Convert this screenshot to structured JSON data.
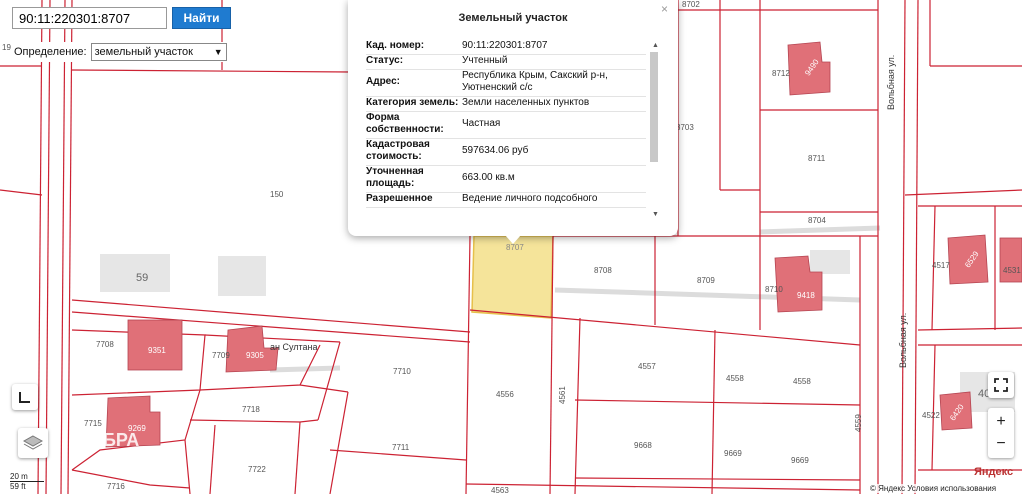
{
  "search": {
    "value": "90:11:220301:8707",
    "button_label": "Найти"
  },
  "definition": {
    "label": "Определение:",
    "selected": "земельный участок"
  },
  "popup": {
    "title": "Земельный участок",
    "close_label": "×",
    "rows": [
      {
        "key": "Кад. номер:",
        "value": "90:11:220301:8707"
      },
      {
        "key": "Статус:",
        "value": "Учтенный"
      },
      {
        "key": "Адрес:",
        "value": "Республика Крым, Сакский р-н, Уютненский с/с"
      },
      {
        "key": "Категория земель:",
        "value": "Земли населенных пунктов"
      },
      {
        "key": "Форма собственности:",
        "value": "Частная"
      },
      {
        "key": "Кадастровая стоимость:",
        "value": "597634.06 руб"
      },
      {
        "key": "Уточненная площадь:",
        "value": "663.00 кв.м"
      },
      {
        "key": "Разрешенное",
        "value": "Ведение личного подсобного"
      }
    ],
    "scroll_up": "▲",
    "scroll_down": "▼"
  },
  "parcels": {
    "p150": "150",
    "p59": "59",
    "p7708": "7708",
    "p9351": "9351",
    "p7709": "7709",
    "p9305": "9305",
    "p7710": "7710",
    "p7718": "7718",
    "p7715": "7715",
    "p9269": "9269",
    "p7711": "7711",
    "p7722": "7722",
    "p7716": "7716",
    "p4563": "4563",
    "p4556": "4556",
    "p4561": "4561",
    "p4557": "4557",
    "p4558a": "4558",
    "p4558b": "4558",
    "p9668": "9668",
    "p9669a": "9669",
    "p9669b": "9669",
    "p4559": "4559",
    "p8707": "8707",
    "p8708": "8708",
    "p8709": "8709",
    "p8710": "8710",
    "p9418": "9418",
    "p8703": "8703",
    "p8704": "8704",
    "p8711": "8711",
    "p8712": "8712",
    "p9490": "9490",
    "p8702": "8702",
    "p4517": "4517",
    "p4531": "4531",
    "p6529": "6529",
    "p4522": "4522",
    "p6420": "6420",
    "p19": "19",
    "p40": "40"
  },
  "streets": {
    "sultana": "ан Султана",
    "volnaya_top": "Вольбная ул.",
    "volnaya_bottom": "Вольбная ул."
  },
  "controls": {
    "ruler_icon": "ruler-icon",
    "layers_icon": "layers-icon",
    "fullscreen_icon": "fullscreen-icon",
    "zoom_in": "+",
    "zoom_out": "−"
  },
  "scale": {
    "metric": "20 m",
    "imperial": "59 ft"
  },
  "copyright": "© Яндекс  Условия использования",
  "yandex": "Яндекс",
  "watermark": "ЯБРА",
  "colors": {
    "boundary": "#cc2233",
    "building": "#e07078",
    "highlight": "#f5e49a",
    "search_button": "#1f7bd0"
  }
}
